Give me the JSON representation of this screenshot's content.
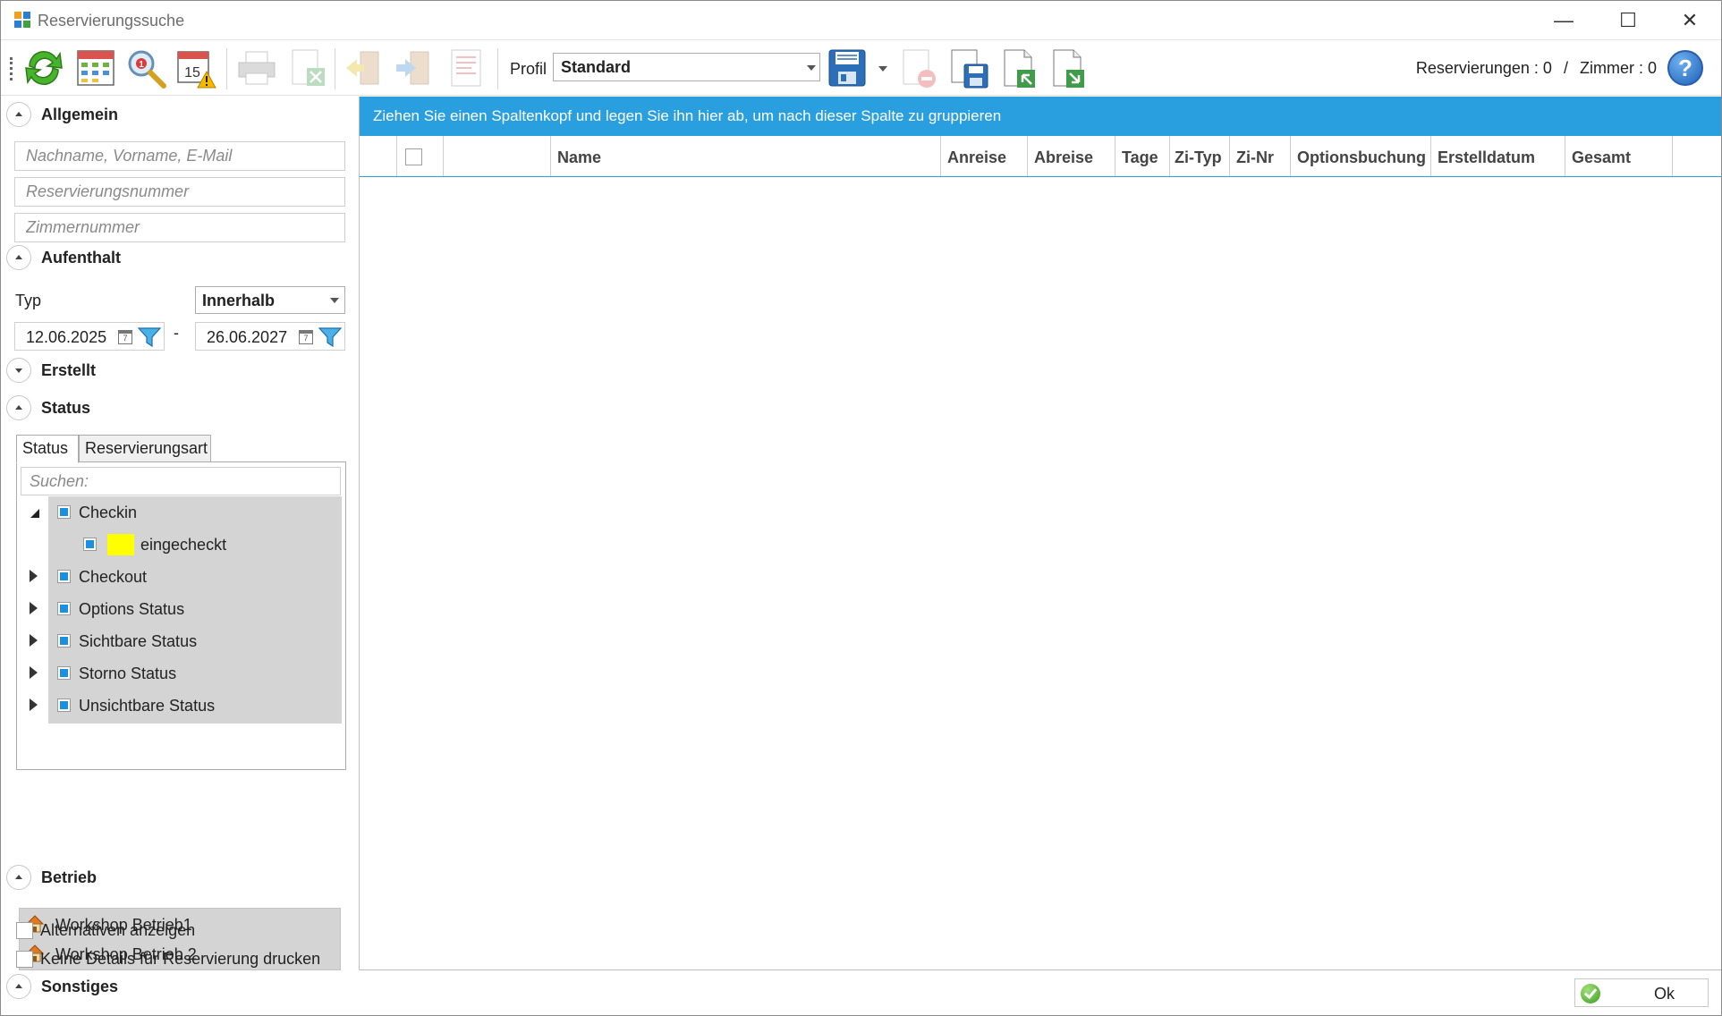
{
  "window": {
    "title": "Reservierungssuche"
  },
  "toolbar": {
    "profil_label": "Profil",
    "profil_value": "Standard",
    "reservierungen": "Reservierungen : 0",
    "separator": "/",
    "zimmer": "Zimmer : 0",
    "help": "?"
  },
  "sections": {
    "allgemein": "Allgemein",
    "aufenthalt": "Aufenthalt",
    "erstellt": "Erstellt",
    "status": "Status",
    "betrieb": "Betrieb",
    "sonstiges": "Sonstiges"
  },
  "allgemein": {
    "name_placeholder": "Nachname, Vorname, E-Mail",
    "resnr_placeholder": "Reservierungsnummer",
    "zimmer_placeholder": "Zimmernummer"
  },
  "aufenthalt": {
    "typ_label": "Typ",
    "typ_value": "Innerhalb",
    "date_from": "12.06.2025",
    "dash": "-",
    "date_to": "26.06.2027"
  },
  "status": {
    "tabs": [
      "Status",
      "Reservierungsart"
    ],
    "search_placeholder": "Suchen:",
    "tree": [
      {
        "label": "Checkin",
        "expanded": true,
        "children": [
          {
            "label": "eingecheckt",
            "color": "#ffff00"
          }
        ]
      },
      {
        "label": "Checkout",
        "expanded": false
      },
      {
        "label": "Options Status",
        "expanded": false
      },
      {
        "label": "Sichtbare Status",
        "expanded": false
      },
      {
        "label": "Storno Status",
        "expanded": false
      },
      {
        "label": "Unsichtbare Status",
        "expanded": false
      }
    ]
  },
  "betrieb": {
    "items": [
      "Workshop Betrieb1",
      "Workshop Betrieb 2"
    ]
  },
  "sonstiges": {
    "alternativen": "Alternativen anzeigen",
    "keine_details": "Keine Details für Reservierung drucken"
  },
  "grid": {
    "group_hint": "Ziehen Sie einen Spaltenkopf und legen Sie ihn hier ab, um nach dieser Spalte zu gruppieren",
    "columns": [
      "Name",
      "Anreise",
      "Abreise",
      "Tage",
      "Zi-Typ",
      "Zi-Nr",
      "Optionsbuchung",
      "Erstelldatum",
      "Gesamt"
    ]
  },
  "footer": {
    "ok": "Ok"
  },
  "colors": {
    "accent": "#2a9fe0",
    "selection_bg": "#d4d4d4",
    "checkbox_fill": "#1b8fe0"
  }
}
